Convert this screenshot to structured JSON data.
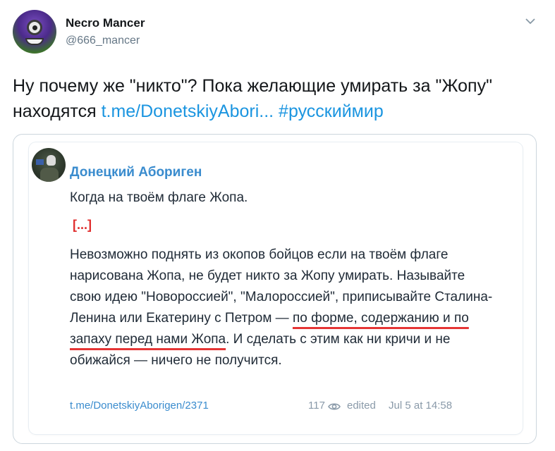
{
  "tweet": {
    "display_name": "Necro Mancer",
    "username": "@666_mancer",
    "text_prefix": "Ну почему же \"никто\"? Пока желающие умирать за \"Жопу\" находятся ",
    "link": "t.me/DonetskiyAbori...",
    "hashtag": "#русскиймир"
  },
  "telegram_post": {
    "channel_name": "Донецкий Абориген",
    "first_line": "Когда на твоём флаге Жопа.",
    "ellipsis": "[...]",
    "body_before": "Невозможно поднять из окопов бойцов если на твоём флаге нарисована Жопа, не будет никто за Жопу умирать. Называйте свою идею \"Новороссией\", \"Малороссией\", приписывайте Сталина-Ленина или Екатерину с Петром — ",
    "body_highlight": "по форме, содержанию и по запаху перед нами Жопа",
    "body_after": ". И сделать с этим как ни кричи и не обижайся — ничего не получится.",
    "link": "t.me/DonetskiyAborigen/2371",
    "views": "117",
    "edited_label": "edited",
    "date": "Jul 5 at 14:58"
  },
  "icons": {
    "caret": "chevron-down-icon",
    "views": "eye-icon"
  },
  "colors": {
    "tweet_link": "#1b95e0",
    "channel": "#3a8cce",
    "underline": "#e53535"
  }
}
